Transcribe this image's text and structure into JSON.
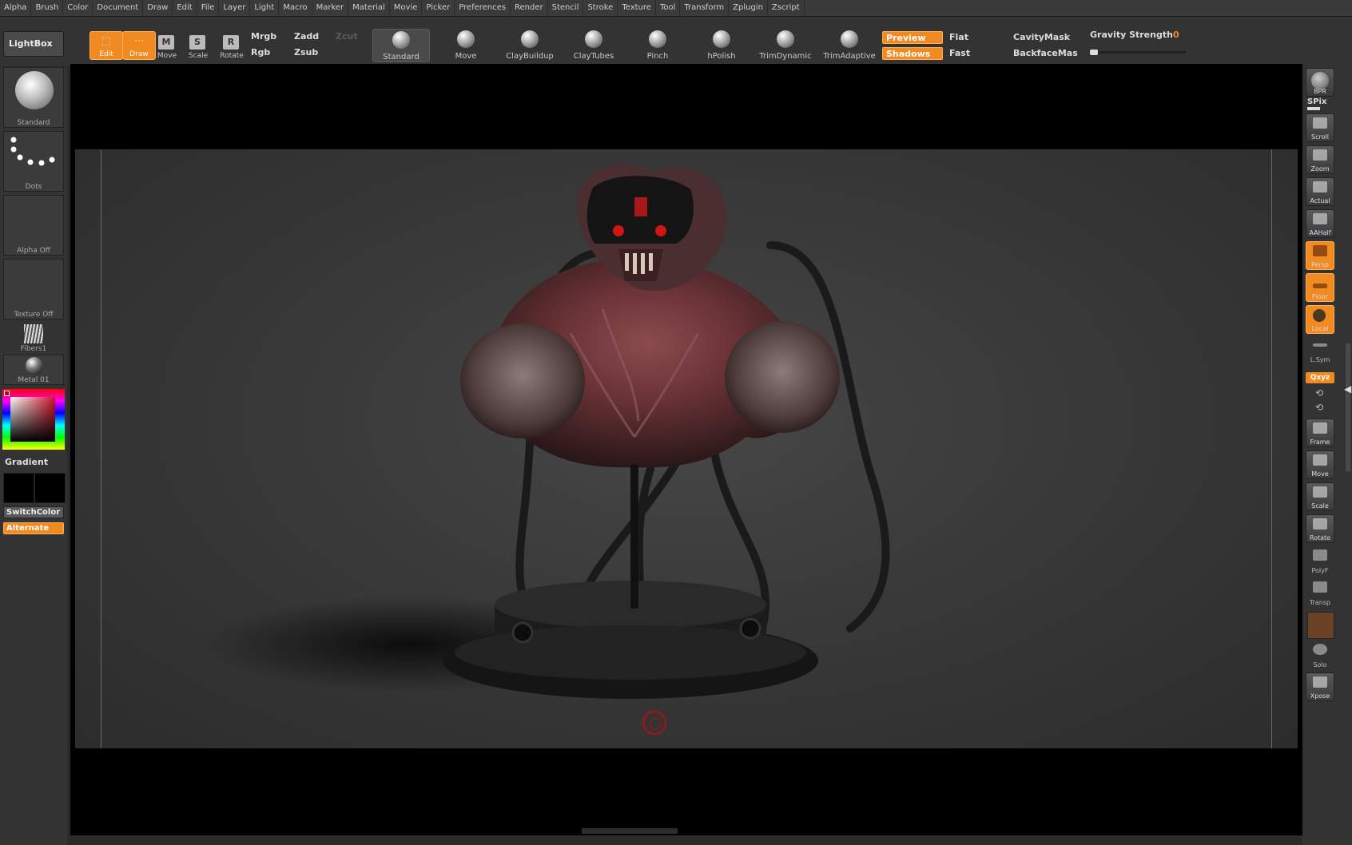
{
  "menu": [
    "Alpha",
    "Brush",
    "Color",
    "Document",
    "Draw",
    "Edit",
    "File",
    "Layer",
    "Light",
    "Macro",
    "Marker",
    "Material",
    "Movie",
    "Picker",
    "Preferences",
    "Render",
    "Stencil",
    "Stroke",
    "Texture",
    "Tool",
    "Transform",
    "Zplugin",
    "Zscript"
  ],
  "toolbar": {
    "lightbox": "LightBox",
    "edit": "Edit",
    "draw": "Draw",
    "move": "Move",
    "scale": "Scale",
    "rotate": "Rotate",
    "move_glyph": "M",
    "scale_glyph": "S",
    "rotate_glyph": "R",
    "mrgb": "Mrgb",
    "rgb": "Rgb",
    "zadd": "Zadd",
    "zsub": "Zsub",
    "zcut": "Zcut",
    "brushes": [
      "Standard",
      "Move",
      "ClayBuildup",
      "ClayTubes",
      "Pinch",
      "hPolish",
      "TrimDynamic",
      "TrimAdaptive"
    ],
    "preview": "Preview",
    "shadows": "Shadows",
    "flat": "Flat",
    "fast": "Fast",
    "cavitymask": "CavityMask",
    "backfacemask": "BackfaceMas",
    "gravity_label": "Gravity Strength",
    "gravity_value": "0"
  },
  "left": {
    "brush": "Standard",
    "stroke": "Dots",
    "alpha": "Alpha  Off",
    "texture": "Texture  Off",
    "fibers": "Fibers1",
    "material": "Metal 01",
    "gradient": "Gradient",
    "switchcolor": "SwitchColor",
    "alternate": "Alternate"
  },
  "right": {
    "bpr": "BPR",
    "spix": "SPix",
    "scroll": "Scroll",
    "zoom": "Zoom",
    "actual": "Actual",
    "aahalf": "AAHalf",
    "persp": "Persp",
    "floor": "Floor",
    "local": "Local",
    "lsym": "L.Sym",
    "xyz": "Qxyz",
    "frame": "Frame",
    "move": "Move",
    "scale": "Scale",
    "rotate": "Rotate",
    "polyf": "PolyF",
    "transp": "Transp",
    "solo": "Solo",
    "xpose": "Xpose"
  },
  "colors": {
    "accent": "#f28a22",
    "panel": "#333333",
    "canvas": "#000000"
  }
}
